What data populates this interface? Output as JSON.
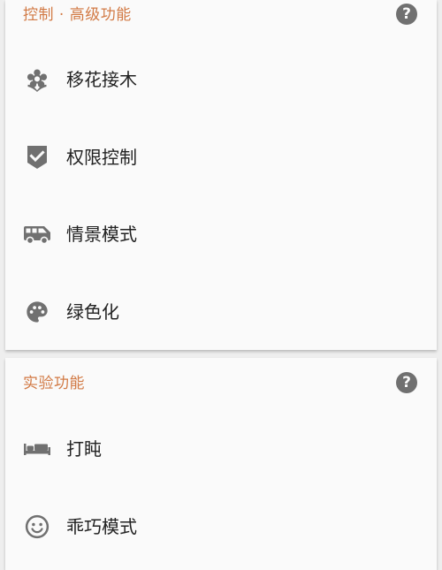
{
  "sections": [
    {
      "title": "控制 · 高级功能",
      "help_icon": "help-circle-icon",
      "items": [
        {
          "label": "移花接木",
          "icon": "flower-icon"
        },
        {
          "label": "权限控制",
          "icon": "shield-check-icon"
        },
        {
          "label": "情景模式",
          "icon": "van-icon"
        },
        {
          "label": "绿色化",
          "icon": "palette-icon"
        }
      ]
    },
    {
      "title": "实验功能",
      "help_icon": "help-circle-icon",
      "items": [
        {
          "label": "打盹",
          "icon": "bed-icon"
        },
        {
          "label": "乖巧模式",
          "icon": "smiley-face-icon"
        }
      ]
    }
  ],
  "colors": {
    "section_title": "#d27a45",
    "icon": "#707070",
    "text": "#222222",
    "card_bg": "#fafafa",
    "page_bg": "#eeeeee"
  }
}
